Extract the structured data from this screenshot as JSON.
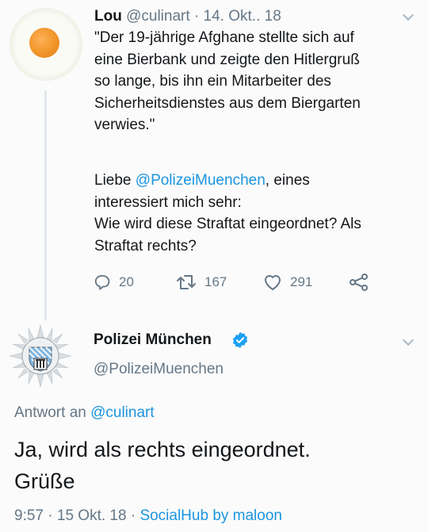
{
  "tweet1": {
    "name": "Lou",
    "handle": "@culinart",
    "sep": " · ",
    "date": "14. Okt.. 18",
    "lines": [
      "\"Der 19-jährige Afghane stellte sich auf",
      "eine Bierbank und zeigte den Hitlergruß",
      "so lange, bis ihn ein Mitarbeiter des",
      "Sicherheitsdienstes aus dem Biergarten",
      "verwies.\""
    ],
    "para2_prefix": "Liebe ",
    "para2_mention": "@PolizeiMuenchen",
    "para2_suffix": ", eines",
    "lines2": [
      "interessiert mich sehr:",
      "Wie wird diese Straftat eingeordnet? Als",
      "Straftat rechts?"
    ],
    "replies": "20",
    "retweets": "167",
    "likes": "291"
  },
  "tweet2": {
    "name": "Polizei München",
    "handle": "@PolizeiMuenchen",
    "reply_prefix": "Antwort an ",
    "reply_mention": "@culinart",
    "text_line1": "Ja, wird als rechts eingeordnet.",
    "text_line2": "Grüße",
    "time": "9:57",
    "sep1": " · ",
    "date": "15 Okt. 18",
    "sep2": " · ",
    "source": "SocialHub by maloon"
  },
  "colors": {
    "link": "#1b95e0",
    "muted": "#657786",
    "text": "#14171a",
    "verified": "#1da1f2"
  }
}
